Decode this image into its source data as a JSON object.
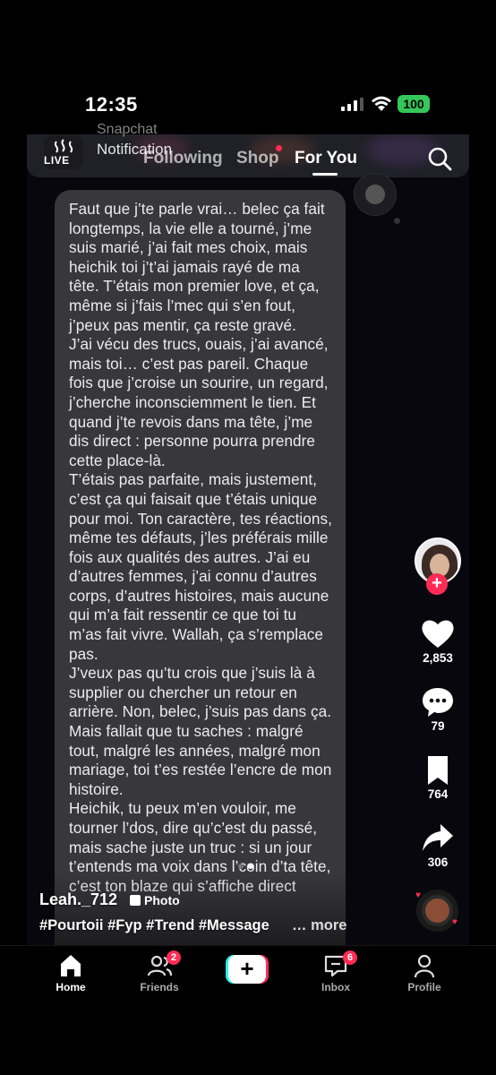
{
  "status_bar": {
    "time": "12:35",
    "battery": "100",
    "colors": {
      "battery": "#34c759"
    }
  },
  "top_nav": {
    "live_label": "LIVE",
    "notification_app": "Snapchat",
    "notification_text": "Notification",
    "tabs": [
      {
        "label": "Following",
        "active": false
      },
      {
        "label": "Shop",
        "active": false,
        "dot": true
      },
      {
        "label": "For You",
        "active": true
      }
    ],
    "search_icon": "search-icon"
  },
  "post": {
    "text": "Faut que j’te parle vrai… belec ça fait longtemps, la vie elle a tourné, j’me suis marié, j’ai fait mes choix, mais heichik toi j’t’ai jamais rayé de ma tête. T’étais mon premier love, et ça, même si j’fais l’mec qui s’en fout, j’peux pas mentir, ça reste gravé.\nJ’ai vécu des trucs, ouais, j’ai avancé, mais toi… c’est pas pareil. Chaque fois que j’croise un sourire, un regard, j’cherche inconsciemment le tien. Et quand j’te revois dans ma tête, j’me dis direct : personne pourra prendre cette place-là.\nT’étais pas parfaite, mais justement, c’est ça qui faisait que t’étais unique pour moi. Ton caractère, tes réactions, même tes défauts, j’les préférais mille fois aux qualités des autres. J’ai eu d’autres femmes, j’ai connu d’autres corps, d’autres histoires, mais aucune qui m’a fait ressentir ce que toi tu m’as fait vivre. Wallah, ça s’remplace pas.\nJ’veux pas qu’tu crois que j’suis là à supplier ou chercher un retour en arrière. Non, belec, j’suis pas dans ça. Mais fallait que tu saches : malgré tout, malgré les années, malgré mon mariage, toi t’es restée l’encre de mon histoire.\nHeichik, tu peux m’en vouloir, me tourner l’dos, dire qu’c’est du passé, mais sache juste un truc : si un jour t’entends ma voix dans l’coin d’ta tête, c’est ton blaze qui s’affiche direct",
    "page_dots": 2,
    "active_page": 2
  },
  "rail": {
    "likes": "2,853",
    "comments": "79",
    "saves": "764",
    "shares": "306",
    "follow_plus": "+",
    "colors": {
      "accent": "#fe2c55"
    }
  },
  "caption": {
    "username": "Leah._712",
    "type_badge": "Photo",
    "hashtags": "#Pourtoii #Fyp #Trend #Message",
    "more": "… more"
  },
  "bottom_nav": {
    "items": [
      {
        "label": "Home",
        "icon": "home-icon",
        "active": true
      },
      {
        "label": "Friends",
        "icon": "friends-icon",
        "badge": "2"
      },
      {
        "label": "",
        "icon": "create-icon"
      },
      {
        "label": "Inbox",
        "icon": "inbox-icon",
        "badge": "6"
      },
      {
        "label": "Profile",
        "icon": "profile-icon"
      }
    ]
  }
}
